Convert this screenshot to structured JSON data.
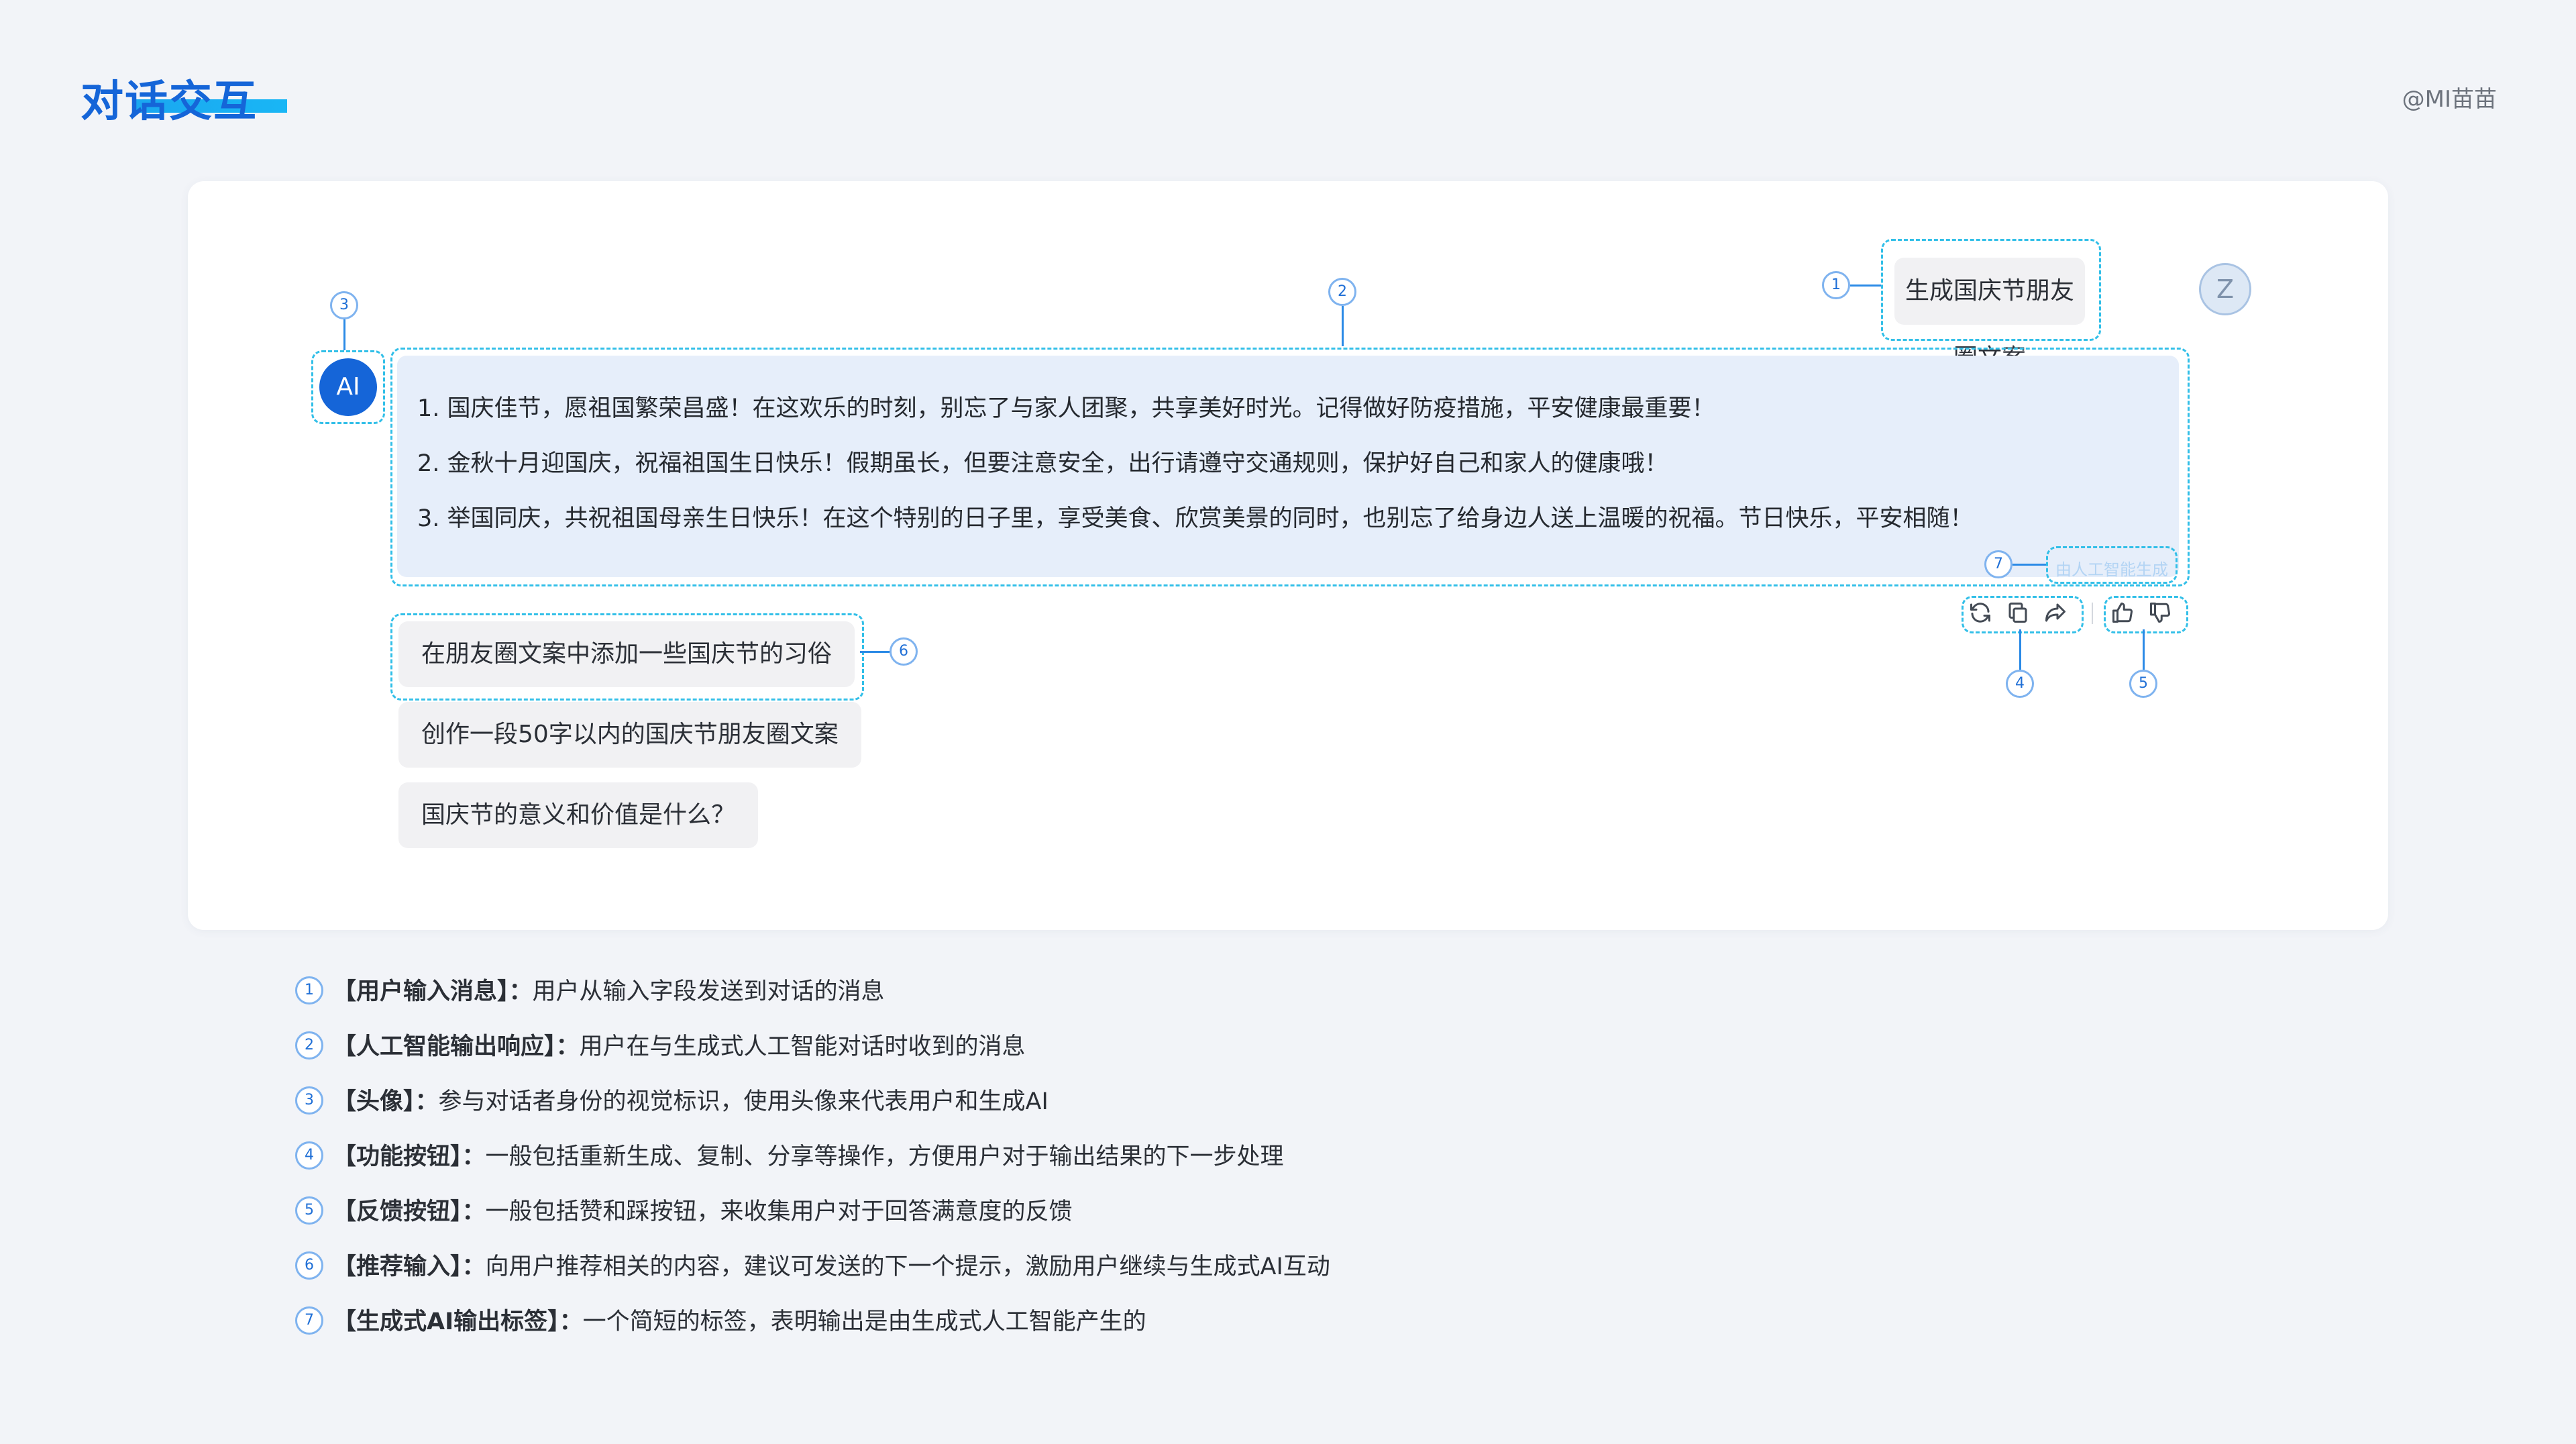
{
  "header": {
    "title": "对话交互",
    "watermark": "@MI苗苗"
  },
  "chat": {
    "user_message": "生成国庆节朋友圈文案",
    "user_avatar": "Z",
    "ai_avatar": "AI",
    "ai_lines": [
      "1. 国庆佳节，愿祖国繁荣昌盛！在这欢乐的时刻，别忘了与家人团聚，共享美好时光。记得做好防疫措施，平安健康最重要！",
      "2. 金秋十月迎国庆，祝福祖国生日快乐！假期虽长，但要注意安全，出行请遵守交通规则，保护好自己和家人的健康哦！",
      "3. 举国同庆，共祝祖国母亲生日快乐！在这个特别的日子里，享受美食、欣赏美景的同时，也别忘了给身边人送上温暖的祝福。节日快乐，平安相随！"
    ],
    "ai_label": "由人工智能生成",
    "actions": [
      "refresh-icon",
      "copy-icon",
      "share-icon"
    ],
    "feedback": [
      "thumbs-up-icon",
      "thumbs-down-icon"
    ],
    "suggestions": [
      "在朋友圈文案中添加一些国庆节的习俗",
      "创作一段50字以内的国庆节朋友圈文案",
      "国庆节的意义和价值是什么？"
    ]
  },
  "callouts": [
    "1",
    "2",
    "3",
    "4",
    "5",
    "6",
    "7"
  ],
  "legend": [
    {
      "num": "1",
      "term": "【用户输入消息】：",
      "desc": "用户从输入字段发送到对话的消息"
    },
    {
      "num": "2",
      "term": "【人工智能输出响应】：",
      "desc": "用户在与生成式人工智能对话时收到的消息"
    },
    {
      "num": "3",
      "term": "【头像】：",
      "desc": "参与对话者身份的视觉标识，使用头像来代表用户和生成AI"
    },
    {
      "num": "4",
      "term": "【功能按钮】：",
      "desc": "一般包括重新生成、复制、分享等操作，方便用户对于输出结果的下一步处理"
    },
    {
      "num": "5",
      "term": "【反馈按钮】：",
      "desc": "一般包括赞和踩按钮，来收集用户对于回答满意度的反馈"
    },
    {
      "num": "6",
      "term": "【推荐输入】：",
      "desc": "向用户推荐相关的内容，建议可发送的下一个提示，激励用户继续与生成式AI互动"
    },
    {
      "num": "7",
      "term": "【生成式AI输出标签】：",
      "desc": "一个简短的标签，表明输出是由生成式人工智能产生的"
    }
  ]
}
